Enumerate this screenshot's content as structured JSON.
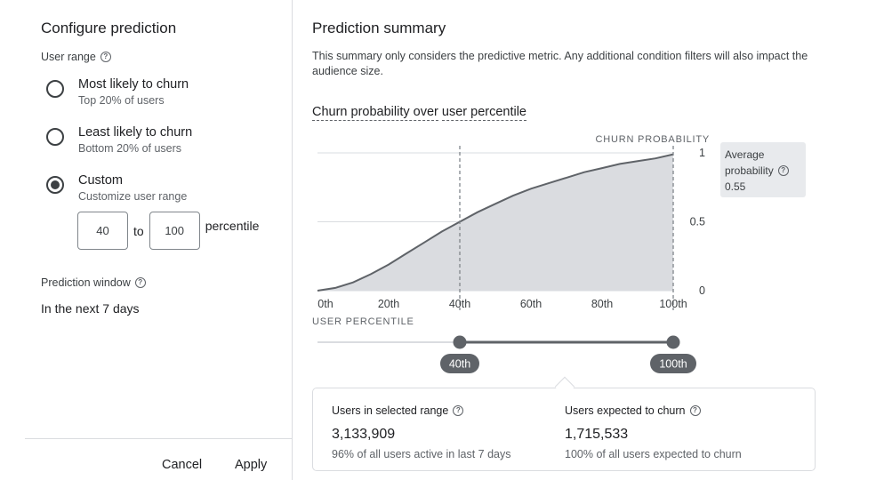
{
  "configure": {
    "title": "Configure prediction",
    "user_range_label": "User range",
    "options": [
      {
        "label": "Most likely to churn",
        "sub": "Top 20% of users",
        "checked": false
      },
      {
        "label": "Least likely to churn",
        "sub": "Bottom 20% of users",
        "checked": false
      },
      {
        "label": "Custom",
        "sub": "Customize user range",
        "checked": true
      }
    ],
    "range": {
      "from": "40",
      "to_label": "to",
      "to": "100",
      "unit": "percentile"
    },
    "prediction_window_label": "Prediction window",
    "prediction_window_value": "In the next 7 days",
    "cancel_label": "Cancel",
    "apply_label": "Apply"
  },
  "summary": {
    "title": "Prediction summary",
    "description": "This summary only considers the predictive metric. Any additional condition filters will also impact the audience size.",
    "chart_title_a": "Churn probability over",
    "chart_title_b": "user percentile",
    "avg_label_1": "Average",
    "avg_label_2": "probability",
    "avg_value": "0.55",
    "slider": {
      "start_label": "40th",
      "end_label": "100th",
      "start": 40,
      "end": 100
    },
    "stats": [
      {
        "label": "Users in selected range",
        "value": "3,133,909",
        "sub": "96% of all users active in last 7 days"
      },
      {
        "label": "Users expected to churn",
        "value": "1,715,533",
        "sub": "100% of all users expected to churn"
      }
    ]
  },
  "colors": {
    "area": "#dadce0",
    "line": "#5f6368",
    "slider": "#5f6368",
    "divider": "#dadce0"
  },
  "icons": {
    "help": "help-icon"
  },
  "chart_data": {
    "type": "area",
    "ylabel": "CHURN PROBABILITY",
    "xlabel": "USER PERCENTILE",
    "x_ticks": [
      "0th",
      "20th",
      "40th",
      "60th",
      "80th",
      "100th"
    ],
    "y_ticks": [
      "0",
      "0.5",
      "1"
    ],
    "xlim": [
      0,
      100
    ],
    "ylim": [
      0,
      1
    ],
    "markers": [
      40,
      100
    ],
    "x": [
      0,
      5,
      10,
      15,
      20,
      25,
      30,
      35,
      40,
      45,
      50,
      55,
      60,
      65,
      70,
      75,
      80,
      85,
      90,
      95,
      100
    ],
    "y": [
      0.0,
      0.02,
      0.06,
      0.12,
      0.19,
      0.27,
      0.35,
      0.43,
      0.5,
      0.57,
      0.63,
      0.69,
      0.74,
      0.78,
      0.82,
      0.86,
      0.89,
      0.92,
      0.94,
      0.96,
      0.99
    ]
  }
}
